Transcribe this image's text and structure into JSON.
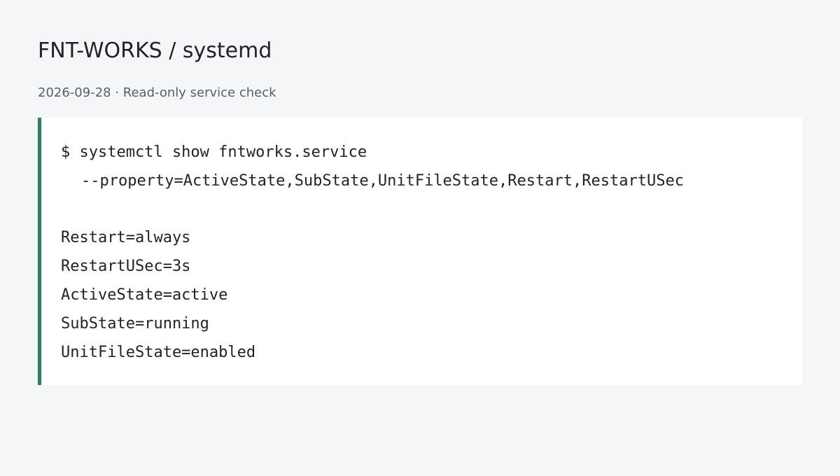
{
  "header": {
    "title": "FNT-WORKS / systemd",
    "subtitle": "2026-09-28 · Read-only service check"
  },
  "terminal": {
    "command_line_1": "$ systemctl show fntworks.service",
    "command_line_2": "--property=ActiveState,SubState,UnitFileState,Restart,RestartUSec",
    "output": [
      "Restart=always",
      "RestartUSec=3s",
      "ActiveState=active",
      "SubState=running",
      "UnitFileState=enabled"
    ]
  },
  "colors": {
    "accent_border": "#2e7d62",
    "page_background": "#f5f6f8",
    "panel_background": "#ffffff"
  }
}
